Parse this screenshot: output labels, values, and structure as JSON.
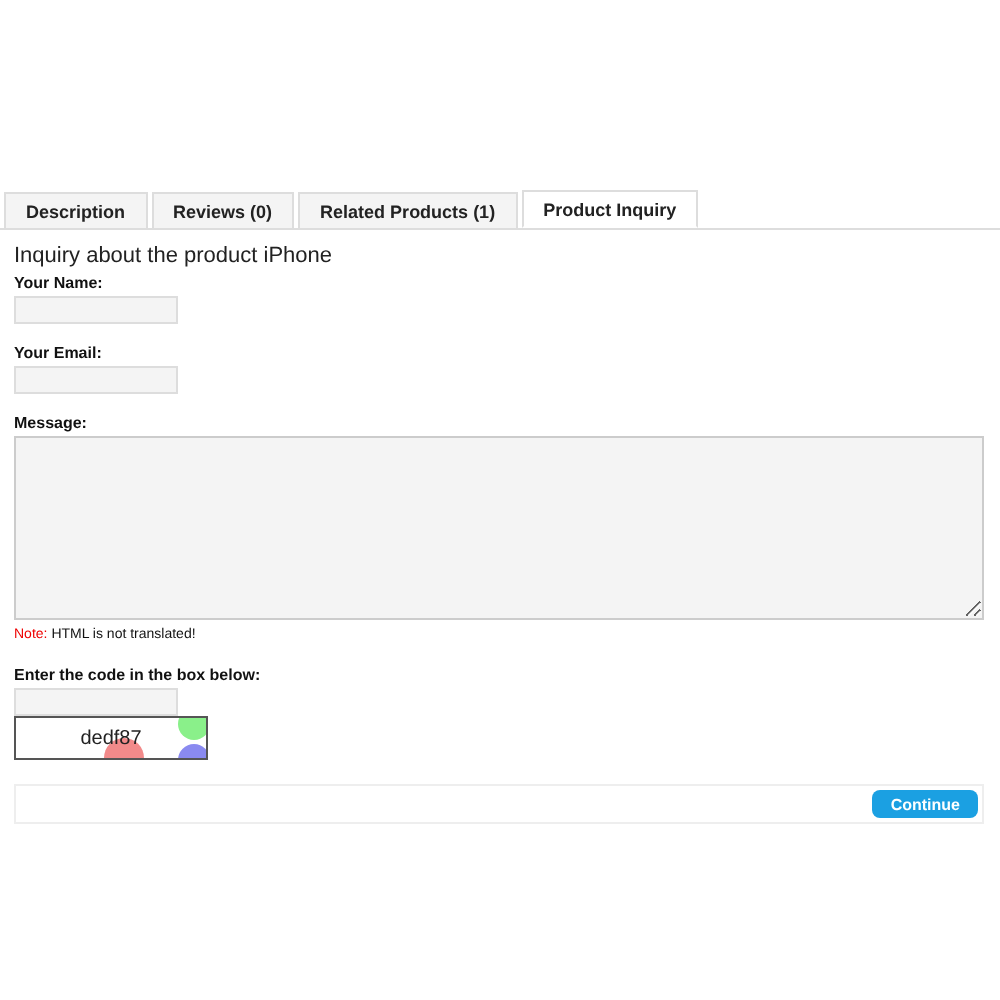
{
  "tabs": [
    {
      "label": "Description",
      "selected": false
    },
    {
      "label": "Reviews (0)",
      "selected": false
    },
    {
      "label": "Related Products (1)",
      "selected": false
    },
    {
      "label": "Product Inquiry",
      "selected": true
    }
  ],
  "heading": "Inquiry about the product iPhone",
  "fields": [
    {
      "label": "Your Name:",
      "kind": "input"
    },
    {
      "label": "Your Email:",
      "kind": "input"
    },
    {
      "label": "Message:",
      "kind": "textarea"
    }
  ],
  "note": {
    "label": "Note:",
    "text": "HTML is not translated!"
  },
  "captcha": {
    "label": "Enter the code in the box below:",
    "code": "dedf87"
  },
  "button": "Continue"
}
